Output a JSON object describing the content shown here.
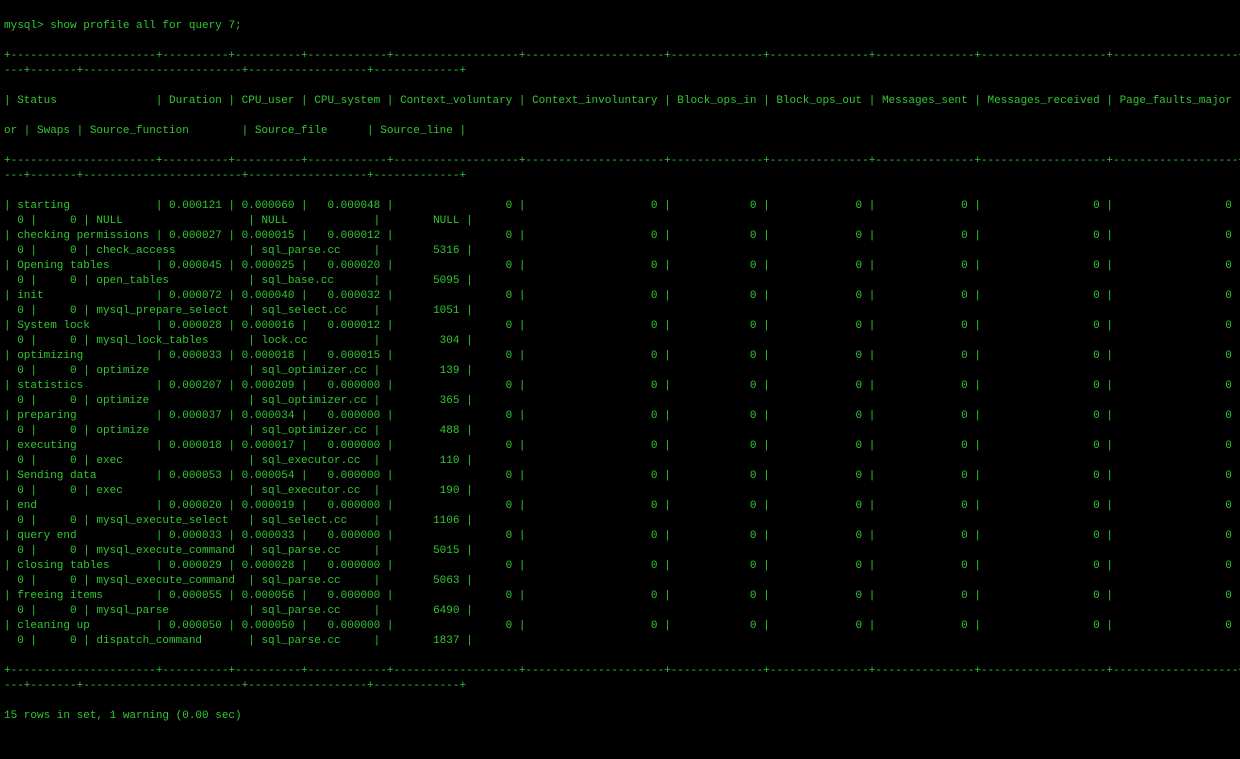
{
  "prompt": "mysql> ",
  "command": "show profile all for query 7;",
  "columns": [
    "Status",
    "Duration",
    "CPU_user",
    "CPU_system",
    "Context_voluntary",
    "Context_involuntary",
    "Block_ops_in",
    "Block_ops_out",
    "Messages_sent",
    "Messages_received",
    "Page_faults_major",
    "Page_faults_minor",
    "Swaps",
    "Source_function",
    "Source_file",
    "Source_line"
  ],
  "rows": [
    {
      "Status": "starting",
      "Duration": "0.000121",
      "CPU_user": "0.000060",
      "CPU_system": "0.000048",
      "Context_voluntary": "0",
      "Context_involuntary": "0",
      "Block_ops_in": "0",
      "Block_ops_out": "0",
      "Messages_sent": "0",
      "Messages_received": "0",
      "Page_faults_major": "0",
      "Page_faults_minor": "0",
      "Swaps": "0",
      "Source_function": "NULL",
      "Source_file": "NULL",
      "Source_line": "NULL"
    },
    {
      "Status": "checking permissions",
      "Duration": "0.000027",
      "CPU_user": "0.000015",
      "CPU_system": "0.000012",
      "Context_voluntary": "0",
      "Context_involuntary": "0",
      "Block_ops_in": "0",
      "Block_ops_out": "0",
      "Messages_sent": "0",
      "Messages_received": "0",
      "Page_faults_major": "0",
      "Page_faults_minor": "0",
      "Swaps": "0",
      "Source_function": "check_access",
      "Source_file": "sql_parse.cc",
      "Source_line": "5316"
    },
    {
      "Status": "Opening tables",
      "Duration": "0.000045",
      "CPU_user": "0.000025",
      "CPU_system": "0.000020",
      "Context_voluntary": "0",
      "Context_involuntary": "0",
      "Block_ops_in": "0",
      "Block_ops_out": "0",
      "Messages_sent": "0",
      "Messages_received": "0",
      "Page_faults_major": "0",
      "Page_faults_minor": "0",
      "Swaps": "0",
      "Source_function": "open_tables",
      "Source_file": "sql_base.cc",
      "Source_line": "5095"
    },
    {
      "Status": "init",
      "Duration": "0.000072",
      "CPU_user": "0.000040",
      "CPU_system": "0.000032",
      "Context_voluntary": "0",
      "Context_involuntary": "0",
      "Block_ops_in": "0",
      "Block_ops_out": "0",
      "Messages_sent": "0",
      "Messages_received": "0",
      "Page_faults_major": "0",
      "Page_faults_minor": "0",
      "Swaps": "0",
      "Source_function": "mysql_prepare_select",
      "Source_file": "sql_select.cc",
      "Source_line": "1051"
    },
    {
      "Status": "System lock",
      "Duration": "0.000028",
      "CPU_user": "0.000016",
      "CPU_system": "0.000012",
      "Context_voluntary": "0",
      "Context_involuntary": "0",
      "Block_ops_in": "0",
      "Block_ops_out": "0",
      "Messages_sent": "0",
      "Messages_received": "0",
      "Page_faults_major": "0",
      "Page_faults_minor": "0",
      "Swaps": "0",
      "Source_function": "mysql_lock_tables",
      "Source_file": "lock.cc",
      "Source_line": "304"
    },
    {
      "Status": "optimizing",
      "Duration": "0.000033",
      "CPU_user": "0.000018",
      "CPU_system": "0.000015",
      "Context_voluntary": "0",
      "Context_involuntary": "0",
      "Block_ops_in": "0",
      "Block_ops_out": "0",
      "Messages_sent": "0",
      "Messages_received": "0",
      "Page_faults_major": "0",
      "Page_faults_minor": "0",
      "Swaps": "0",
      "Source_function": "optimize",
      "Source_file": "sql_optimizer.cc",
      "Source_line": "139"
    },
    {
      "Status": "statistics",
      "Duration": "0.000207",
      "CPU_user": "0.000209",
      "CPU_system": "0.000000",
      "Context_voluntary": "0",
      "Context_involuntary": "0",
      "Block_ops_in": "0",
      "Block_ops_out": "0",
      "Messages_sent": "0",
      "Messages_received": "0",
      "Page_faults_major": "0",
      "Page_faults_minor": "0",
      "Swaps": "0",
      "Source_function": "optimize",
      "Source_file": "sql_optimizer.cc",
      "Source_line": "365"
    },
    {
      "Status": "preparing",
      "Duration": "0.000037",
      "CPU_user": "0.000034",
      "CPU_system": "0.000000",
      "Context_voluntary": "0",
      "Context_involuntary": "0",
      "Block_ops_in": "0",
      "Block_ops_out": "0",
      "Messages_sent": "0",
      "Messages_received": "0",
      "Page_faults_major": "0",
      "Page_faults_minor": "0",
      "Swaps": "0",
      "Source_function": "optimize",
      "Source_file": "sql_optimizer.cc",
      "Source_line": "488"
    },
    {
      "Status": "executing",
      "Duration": "0.000018",
      "CPU_user": "0.000017",
      "CPU_system": "0.000000",
      "Context_voluntary": "0",
      "Context_involuntary": "0",
      "Block_ops_in": "0",
      "Block_ops_out": "0",
      "Messages_sent": "0",
      "Messages_received": "0",
      "Page_faults_major": "0",
      "Page_faults_minor": "0",
      "Swaps": "0",
      "Source_function": "exec",
      "Source_file": "sql_executor.cc",
      "Source_line": "110"
    },
    {
      "Status": "Sending data",
      "Duration": "0.000053",
      "CPU_user": "0.000054",
      "CPU_system": "0.000000",
      "Context_voluntary": "0",
      "Context_involuntary": "0",
      "Block_ops_in": "0",
      "Block_ops_out": "0",
      "Messages_sent": "0",
      "Messages_received": "0",
      "Page_faults_major": "0",
      "Page_faults_minor": "0",
      "Swaps": "0",
      "Source_function": "exec",
      "Source_file": "sql_executor.cc",
      "Source_line": "190"
    },
    {
      "Status": "end",
      "Duration": "0.000020",
      "CPU_user": "0.000019",
      "CPU_system": "0.000000",
      "Context_voluntary": "0",
      "Context_involuntary": "0",
      "Block_ops_in": "0",
      "Block_ops_out": "0",
      "Messages_sent": "0",
      "Messages_received": "0",
      "Page_faults_major": "0",
      "Page_faults_minor": "0",
      "Swaps": "0",
      "Source_function": "mysql_execute_select",
      "Source_file": "sql_select.cc",
      "Source_line": "1106"
    },
    {
      "Status": "query end",
      "Duration": "0.000033",
      "CPU_user": "0.000033",
      "CPU_system": "0.000000",
      "Context_voluntary": "0",
      "Context_involuntary": "0",
      "Block_ops_in": "0",
      "Block_ops_out": "0",
      "Messages_sent": "0",
      "Messages_received": "0",
      "Page_faults_major": "0",
      "Page_faults_minor": "0",
      "Swaps": "0",
      "Source_function": "mysql_execute_command",
      "Source_file": "sql_parse.cc",
      "Source_line": "5015"
    },
    {
      "Status": "closing tables",
      "Duration": "0.000029",
      "CPU_user": "0.000028",
      "CPU_system": "0.000000",
      "Context_voluntary": "0",
      "Context_involuntary": "0",
      "Block_ops_in": "0",
      "Block_ops_out": "0",
      "Messages_sent": "0",
      "Messages_received": "0",
      "Page_faults_major": "0",
      "Page_faults_minor": "0",
      "Swaps": "0",
      "Source_function": "mysql_execute_command",
      "Source_file": "sql_parse.cc",
      "Source_line": "5063"
    },
    {
      "Status": "freeing items",
      "Duration": "0.000055",
      "CPU_user": "0.000056",
      "CPU_system": "0.000000",
      "Context_voluntary": "0",
      "Context_involuntary": "0",
      "Block_ops_in": "0",
      "Block_ops_out": "0",
      "Messages_sent": "0",
      "Messages_received": "0",
      "Page_faults_major": "0",
      "Page_faults_minor": "0",
      "Swaps": "0",
      "Source_function": "mysql_parse",
      "Source_file": "sql_parse.cc",
      "Source_line": "6490"
    },
    {
      "Status": "cleaning up",
      "Duration": "0.000050",
      "CPU_user": "0.000050",
      "CPU_system": "0.000000",
      "Context_voluntary": "0",
      "Context_involuntary": "0",
      "Block_ops_in": "0",
      "Block_ops_out": "0",
      "Messages_sent": "0",
      "Messages_received": "0",
      "Page_faults_major": "0",
      "Page_faults_minor": "0",
      "Swaps": "0",
      "Source_function": "dispatch_command",
      "Source_file": "sql_parse.cc",
      "Source_line": "1837"
    }
  ],
  "footer": "15 rows in set, 1 warning (0.00 sec)",
  "widths": {
    "Status": 20,
    "Duration": 8,
    "CPU_user": 8,
    "CPU_system": 10,
    "Context_voluntary": 17,
    "Context_involuntary": 19,
    "Block_ops_in": 12,
    "Block_ops_out": 13,
    "Messages_sent": 13,
    "Messages_received": 17,
    "Page_faults_major": 17,
    "Page_faults_minor": 17,
    "Swaps": 5,
    "Source_function": 22,
    "Source_file": 16,
    "Source_line": 11
  },
  "first_line_cols": [
    "Status",
    "Duration",
    "CPU_user",
    "CPU_system",
    "Context_voluntary",
    "Context_involuntary",
    "Block_ops_in",
    "Block_ops_out",
    "Messages_sent",
    "Messages_received",
    "Page_faults_major"
  ],
  "first_line_trail": "Page_faults_min",
  "second_line_lead": "or",
  "second_line_cols": [
    "Swaps",
    "Source_function",
    "Source_file",
    "Source_line"
  ],
  "data_first_line_cols": [
    "Status",
    "Duration",
    "CPU_user",
    "CPU_system",
    "Context_voluntary",
    "Context_involuntary",
    "Block_ops_in",
    "Block_ops_out",
    "Messages_sent",
    "Messages_received",
    "Page_faults_major",
    "Page_faults_minor"
  ],
  "data_second_line_cols": [
    "Swaps",
    "Source_function",
    "Source_file",
    "Source_line"
  ],
  "numeric_cols": [
    "Duration",
    "CPU_user",
    "CPU_system",
    "Context_voluntary",
    "Context_involuntary",
    "Block_ops_in",
    "Block_ops_out",
    "Messages_sent",
    "Messages_received",
    "Page_faults_major",
    "Page_faults_minor",
    "Swaps",
    "Source_line"
  ]
}
